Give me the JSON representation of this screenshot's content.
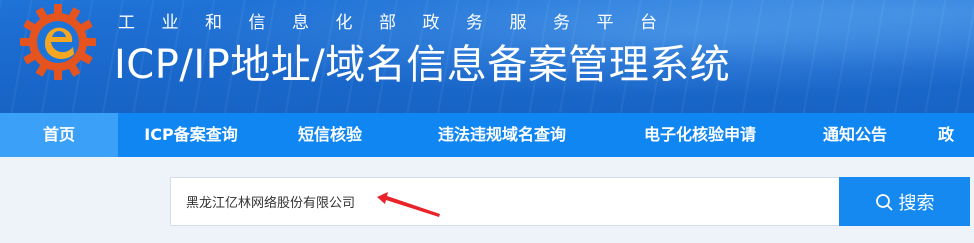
{
  "header": {
    "subtitle": "工业和信息化部政务服务平台",
    "title": "ICP/IP地址/域名信息备案管理系统",
    "logo_icon": "miit-gear-e-logo",
    "logo_colors": {
      "gear": "#e5531f",
      "inner": "#1d74d8",
      "accent": "#f5a623"
    }
  },
  "nav": {
    "items": [
      {
        "label": "首页",
        "active": true
      },
      {
        "label": "ICP备案查询",
        "active": false
      },
      {
        "label": "短信核验",
        "active": false
      },
      {
        "label": "违法违规域名查询",
        "active": false
      },
      {
        "label": "电子化核验申请",
        "active": false
      },
      {
        "label": "通知公告",
        "active": false
      },
      {
        "label": "政",
        "active": false
      }
    ]
  },
  "search": {
    "value": "黑龙江亿林网络股份有限公司",
    "button_label": "搜索",
    "button_icon": "search-icon"
  },
  "annotation": {
    "icon": "red-arrow-icon",
    "color": "#e8232a"
  },
  "colors": {
    "header_blue": "#1a68cc",
    "nav_blue": "#0f86f2",
    "nav_active": "#3aa0f8",
    "button_blue": "#1689f0",
    "page_bg": "#eef3f9"
  }
}
